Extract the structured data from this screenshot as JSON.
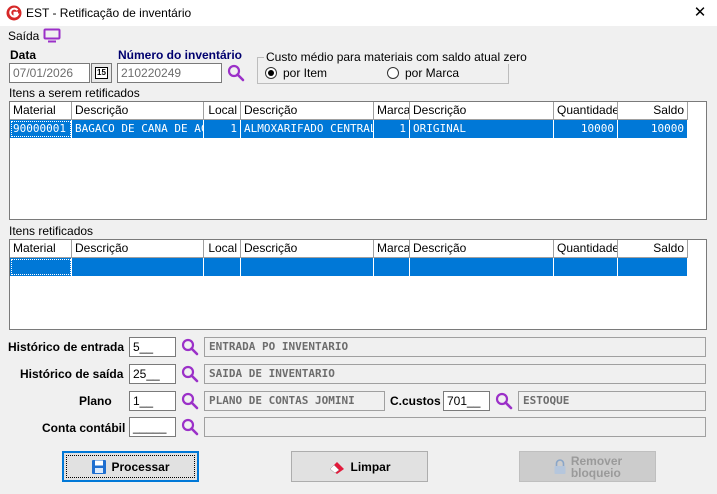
{
  "window": {
    "title": "EST - Retificação de inventário",
    "close_glyph": "✕"
  },
  "menu": {
    "saida_label": "Saída"
  },
  "data_field": {
    "label": "Data",
    "value": "07/01/2026",
    "calendar_day": "15"
  },
  "inventario": {
    "label": "Número do inventário",
    "value": "210220249"
  },
  "custo": {
    "title": "Custo médio para materiais com saldo atual zero",
    "opt_item": "por Item",
    "opt_marca": "por Marca",
    "selected": "por Item"
  },
  "grid1": {
    "title": "Itens a serem retificados",
    "columns": [
      "Material",
      "Descrição",
      "Local",
      "Descrição",
      "Marca",
      "Descrição",
      "Quantidade",
      "Saldo"
    ],
    "rows": [
      [
        "90000001",
        "BAGACO DE CANA DE ACUCAR",
        "1",
        "ALMOXARIFADO CENTRAL",
        "1",
        "ORIGINAL",
        "10000",
        "10000"
      ]
    ]
  },
  "grid2": {
    "title": "Itens retificados",
    "columns": [
      "Material",
      "Descrição",
      "Local",
      "Descrição",
      "Marca",
      "Descrição",
      "Quantidade",
      "Saldo"
    ]
  },
  "historico_entrada": {
    "label": "Histórico de entrada",
    "code": "5__",
    "desc": "ENTRADA PO INVENTARIO"
  },
  "historico_saida": {
    "label": "Histórico de saída",
    "code": "25__",
    "desc": "SAIDA DE INVENTARIO"
  },
  "plano": {
    "label": "Plano",
    "code": "1__",
    "desc": "PLANO DE CONTAS JOMINI"
  },
  "ccustos": {
    "label": "C.custos",
    "code": "701__",
    "desc": "ESTOQUE"
  },
  "conta": {
    "label": "Conta contábil",
    "code": "_____",
    "desc": ""
  },
  "buttons": {
    "processar": "Processar",
    "limpar": "Limpar",
    "remover_l1": "Remover",
    "remover_l2": "bloqueio"
  },
  "colors": {
    "selection": "#0078d7",
    "accent_purple": "#9b30c8",
    "label_blue": "#00006e"
  }
}
